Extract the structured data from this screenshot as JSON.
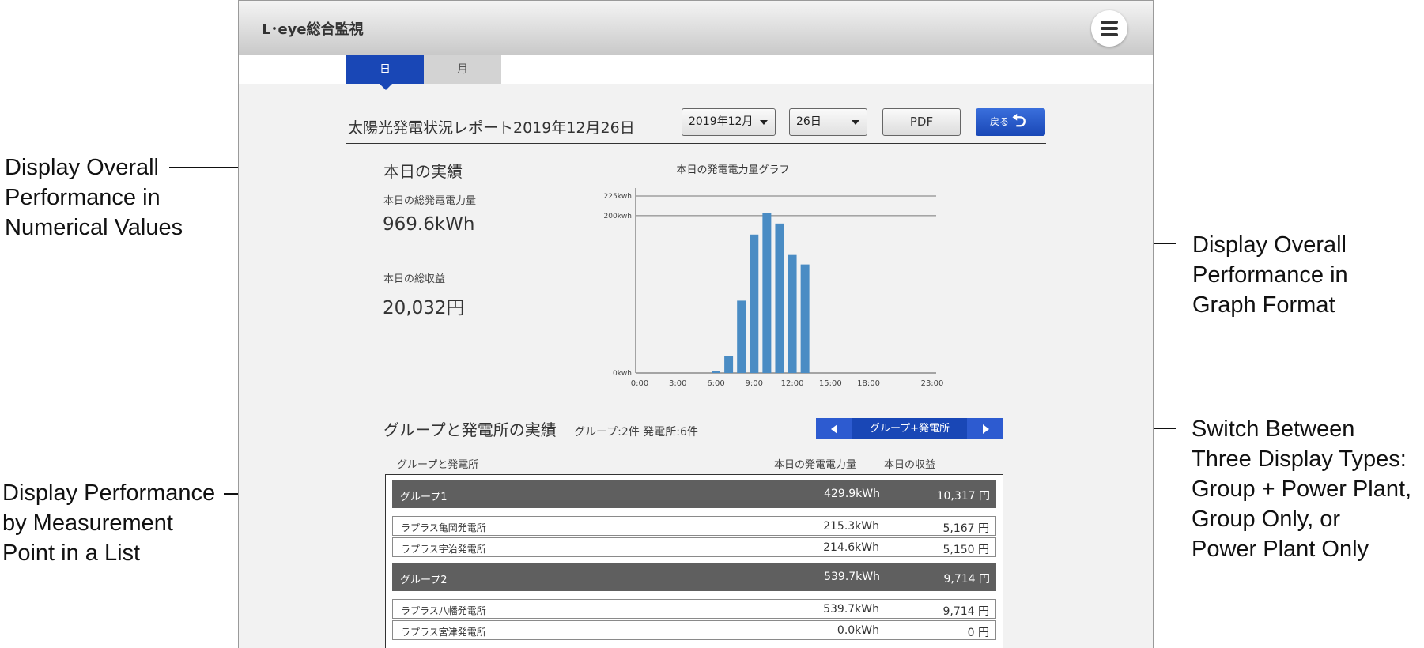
{
  "annotations": {
    "left_top": [
      "Display Overall",
      "Performance in",
      "Numerical Values"
    ],
    "left_bottom": [
      "Display Performance",
      "by Measurement",
      "Point in a List"
    ],
    "right_top": [
      "Display Overall",
      "Performance in",
      "Graph Format"
    ],
    "right_bottom": [
      "Switch Between",
      "Three Display Types:",
      "Group + Power Plant,",
      "Group Only, or",
      "Power Plant Only"
    ]
  },
  "app": {
    "title": "L･eye総合監視",
    "menu_icon": "hamburger-menu-icon"
  },
  "tabs": [
    {
      "label": "日",
      "active": true
    },
    {
      "label": "月",
      "active": false
    }
  ],
  "report": {
    "title": "太陽光発電状況レポート2019年12月26日",
    "month_select": "2019年12月",
    "day_select": "26日",
    "pdf_label": "PDF",
    "back_label": "戻る",
    "back_icon": "undo-arrow-icon"
  },
  "today": {
    "heading": "本日の実績",
    "total_power_label": "本日の総発電電力量",
    "total_power_value": "969.6kWh",
    "total_revenue_label": "本日の総収益",
    "total_revenue_value": "20,032円"
  },
  "chart_data": {
    "type": "bar",
    "title": "本日の発電電力量グラフ",
    "y_ticks": [
      "225kwh",
      "200kwh",
      "0kwh"
    ],
    "y_tick_values": [
      225,
      200,
      0
    ],
    "ylim": [
      0,
      225
    ],
    "x_tick_labels": [
      "0:00",
      "3:00",
      "6:00",
      "9:00",
      "12:00",
      "15:00",
      "18:00",
      "23:00"
    ],
    "x_tick_hours": [
      0,
      3,
      6,
      9,
      12,
      15,
      18,
      23
    ],
    "bar_hours": [
      6,
      7,
      8,
      9,
      10,
      11,
      12,
      13
    ],
    "values": [
      2,
      22,
      92,
      176,
      203,
      190,
      150,
      138
    ],
    "bar_color": "#4a8cc4"
  },
  "groups_section": {
    "heading": "グループと発電所の実績",
    "counts": "グループ:2件 発電所:6件",
    "toggle_label": "グループ+発電所",
    "col_name": "グループと発電所",
    "col_power": "本日の発電電力量",
    "col_revenue": "本日の収益",
    "rows": [
      {
        "kind": "group",
        "name": "グループ1",
        "kwh": "429.9kWh",
        "yen": "10,317 円"
      },
      {
        "kind": "plant",
        "name": "ラプラス亀岡発電所",
        "kwh": "215.3kWh",
        "yen": "5,167 円"
      },
      {
        "kind": "plant",
        "name": "ラプラス宇治発電所",
        "kwh": "214.6kWh",
        "yen": "5,150 円"
      },
      {
        "kind": "group",
        "name": "グループ2",
        "kwh": "539.7kWh",
        "yen": "9,714 円"
      },
      {
        "kind": "plant",
        "name": "ラプラス八幡発電所",
        "kwh": "539.7kWh",
        "yen": "9,714 円"
      },
      {
        "kind": "plant",
        "name": "ラプラス宮津発電所",
        "kwh": "0.0kWh",
        "yen": "0 円"
      }
    ]
  }
}
